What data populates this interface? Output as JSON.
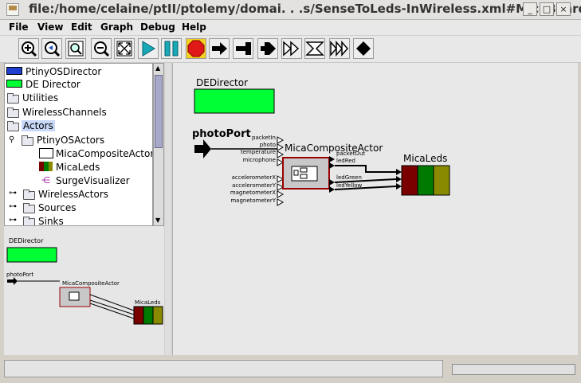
{
  "window": {
    "title": "file:/home/celaine/ptII/ptolemy/domai. . .s/SenseToLeds-InWireless.xml#MicaBoard",
    "buttons": [
      "_",
      "□",
      "×"
    ]
  },
  "menu": [
    "File",
    "View",
    "Edit",
    "Graph",
    "Debug",
    "Help"
  ],
  "toolbar": {
    "buttons": [
      "zoom-in",
      "zoom-reset",
      "zoom-fit",
      "zoom-out",
      "full-screen",
      "run",
      "pause",
      "stop",
      "step-forward",
      "step-end",
      "step-back",
      "fast-forward",
      "fast-end",
      "fast-fast",
      "diamond"
    ]
  },
  "tree": {
    "items": [
      {
        "label": "PtinyOSDirector",
        "icon": "director-icon"
      },
      {
        "label": "DE Director",
        "icon": "green-director-icon"
      },
      {
        "label": "Utilities",
        "icon": "folder-icon"
      },
      {
        "label": "WirelessChannels",
        "icon": "folder-icon"
      },
      {
        "label": "Actors",
        "icon": "folder-icon",
        "selected": true
      },
      {
        "label": "PtinyOSActors",
        "icon": "folder-icon",
        "expanded": true
      },
      {
        "label": "MicaCompositeActor",
        "icon": "composite-icon"
      },
      {
        "label": "MicaLeds",
        "icon": "leds-icon"
      },
      {
        "label": "SurgeVisualizer",
        "icon": "visualizer-icon"
      },
      {
        "label": "WirelessActors",
        "icon": "folder-icon"
      },
      {
        "label": "Sources",
        "icon": "folder-icon"
      },
      {
        "label": "Sinks",
        "icon": "folder-icon"
      }
    ]
  },
  "diagram": {
    "director_label": "DEDirector",
    "port_label": "photoPort",
    "actor_label": "MicaCompositeActor",
    "leds_label": "MicaLeds",
    "inputs": [
      "packetIn",
      "photo",
      "temperature",
      "microphone",
      "accelerometerX",
      "accelerometerY",
      "magnetometerX",
      "magnetometerY"
    ],
    "outputs": [
      "packetOut",
      "ledRed",
      "ledGreen",
      "ledYellow"
    ]
  },
  "colors": {
    "director": "#00ff33",
    "led_red": "#7a0000",
    "led_green": "#007a00",
    "led_yellow": "#8a8a00",
    "actor_border": "#990000",
    "selected_tree": "#c8d8f8"
  }
}
